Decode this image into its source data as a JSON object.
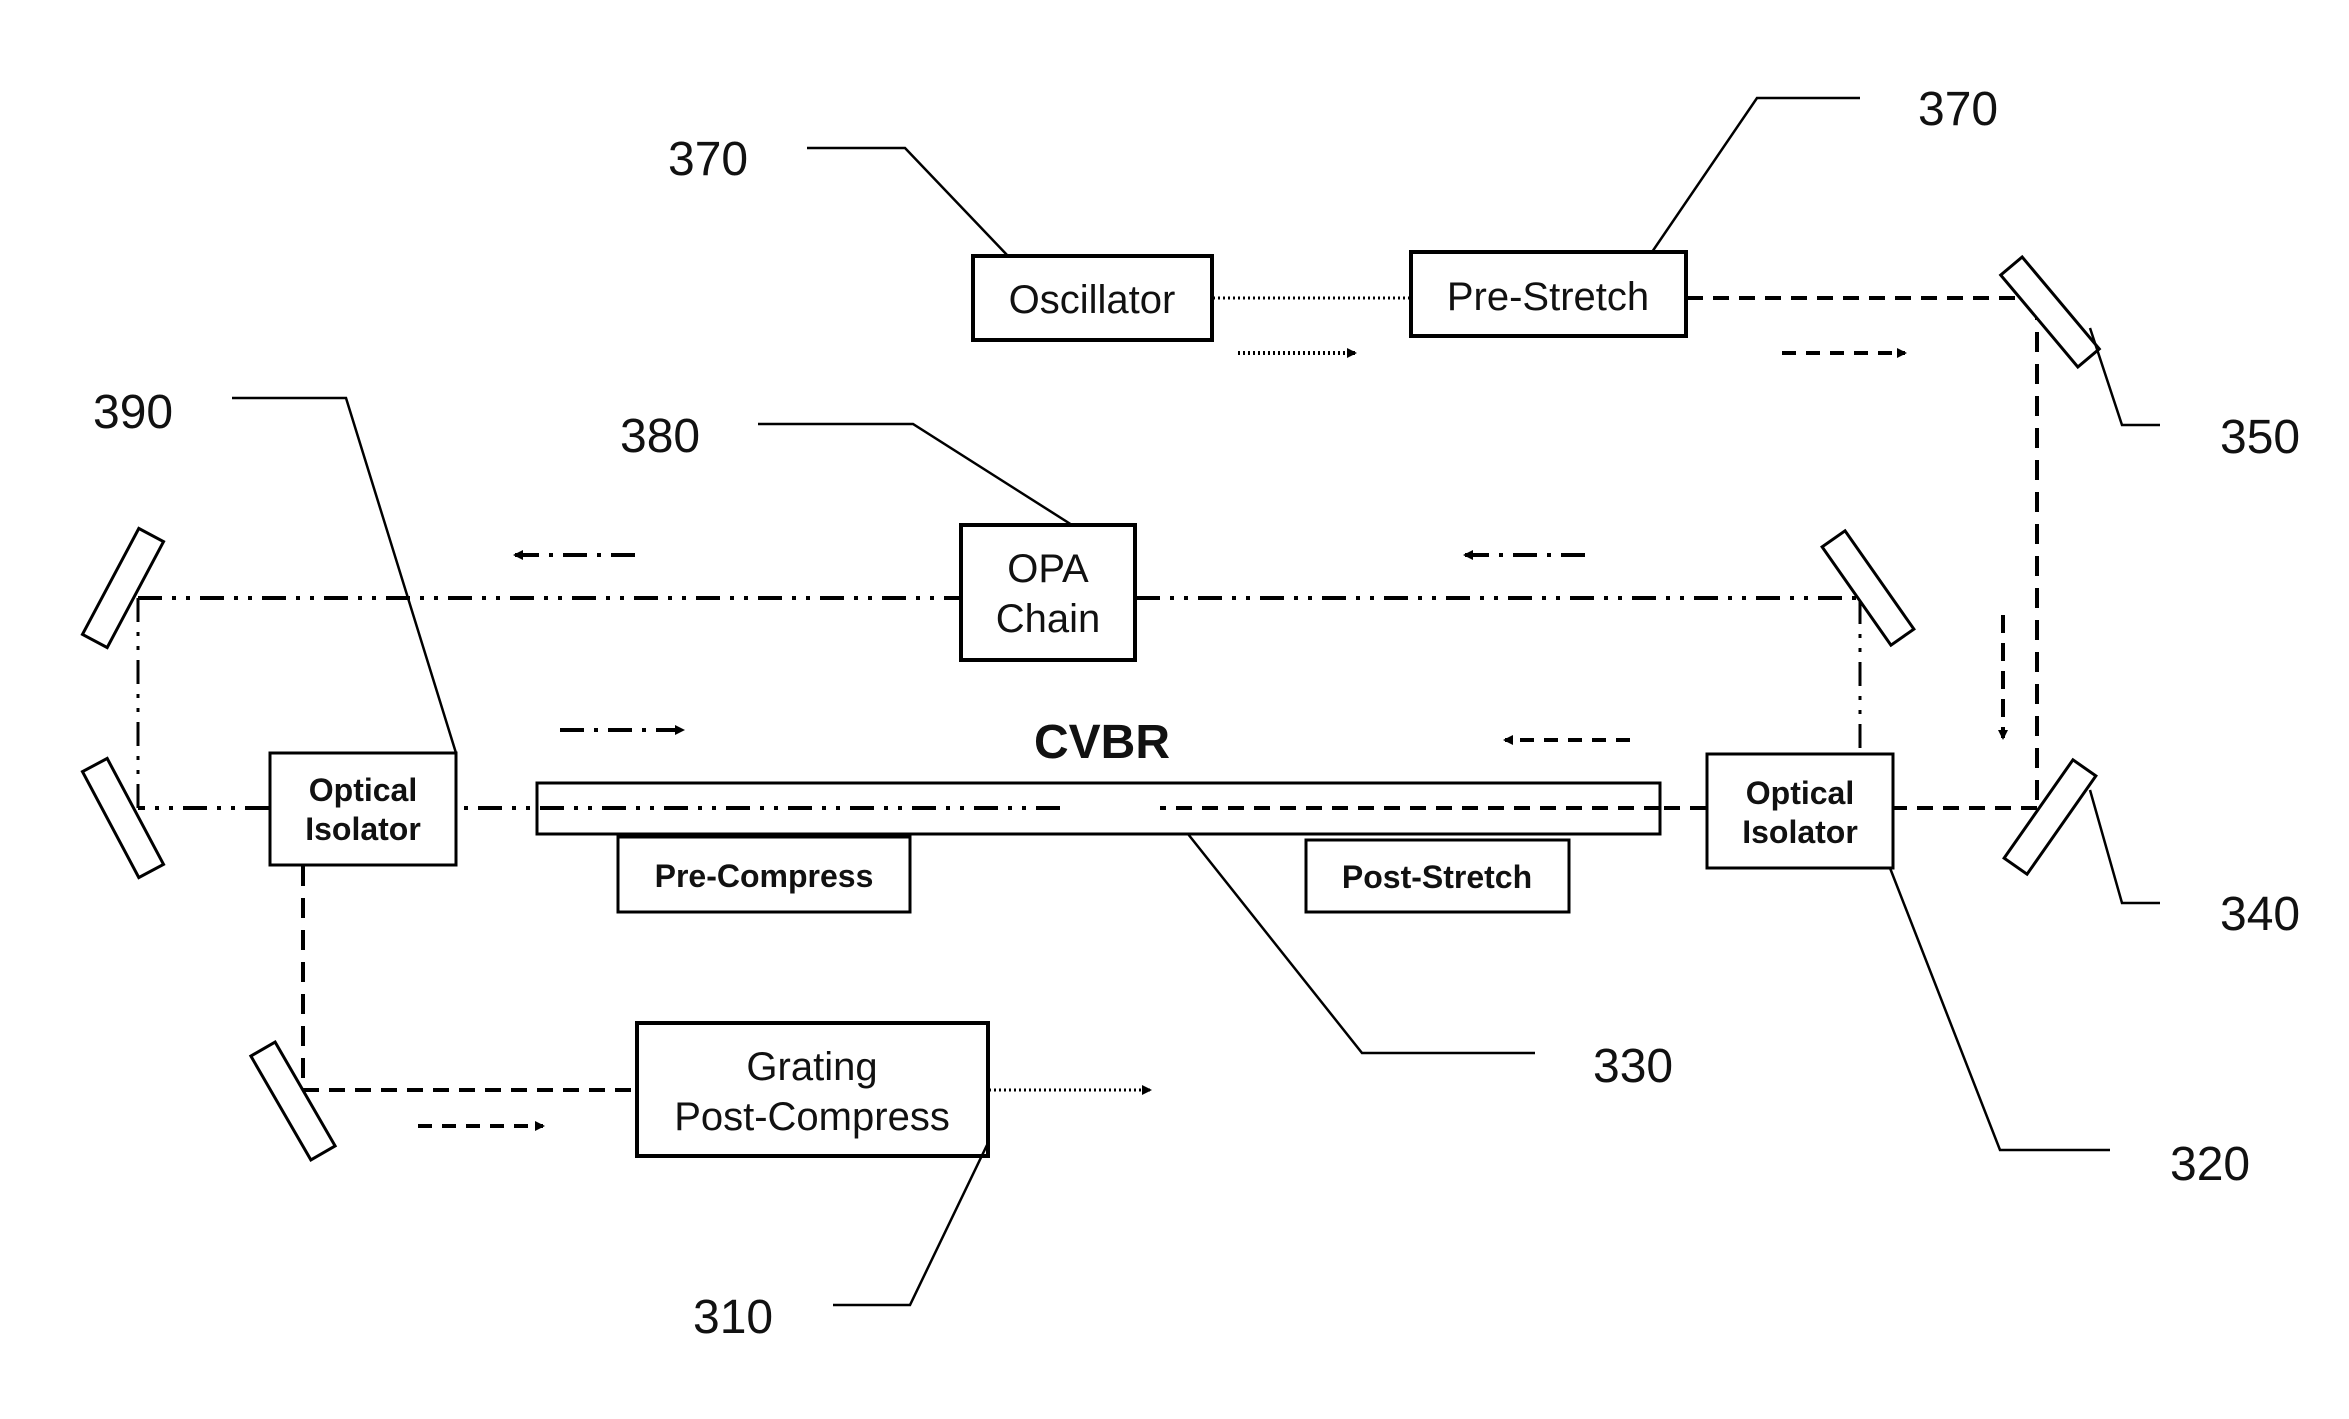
{
  "diagram": {
    "title": "CVBR",
    "components": {
      "oscillator": {
        "label": "Oscillator"
      },
      "pre_stretch": {
        "label": "Pre-Stretch"
      },
      "opa_chain": {
        "lines": [
          "OPA",
          "Chain"
        ]
      },
      "optical_isolator_left": {
        "lines": [
          "Optical",
          "Isolator"
        ]
      },
      "optical_isolator_right": {
        "lines": [
          "Optical",
          "Isolator"
        ]
      },
      "pre_compress": {
        "label": "Pre-Compress"
      },
      "post_stretch": {
        "label": "Post-Stretch"
      },
      "grating_post_compress": {
        "lines": [
          "Grating",
          "Post-Compress"
        ]
      }
    },
    "reference_numerals": {
      "oscillator": "370",
      "pre_stretch": "370",
      "opa_chain": "380",
      "optical_isolator_left": "390",
      "mirror_350": "350",
      "mirror_340": "340",
      "cvbr": "330",
      "optical_isolator_right": "320",
      "grating": "310"
    },
    "beam_styles": {
      "oscillator_output": "dotted",
      "stretched_pulse": "dashed",
      "amplified_pulse": "dash-dot"
    }
  }
}
